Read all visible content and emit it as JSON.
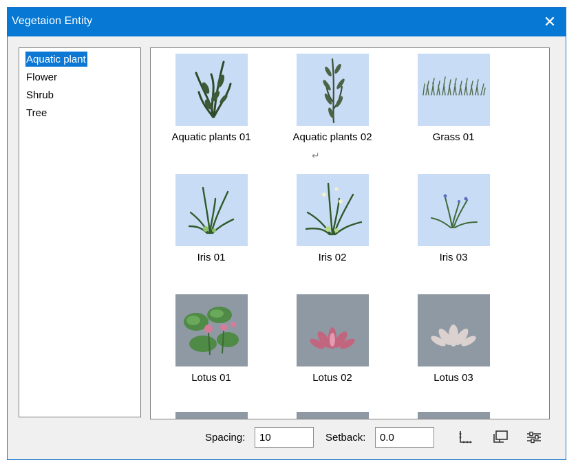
{
  "window": {
    "title": "Vegetaion Entity",
    "close_label": "✕"
  },
  "categories": [
    {
      "label": "Aquatic plant",
      "selected": true
    },
    {
      "label": "Flower",
      "selected": false
    },
    {
      "label": "Shrub",
      "selected": false
    },
    {
      "label": "Tree",
      "selected": false
    }
  ],
  "gallery": {
    "items": [
      {
        "label": "Aquatic plants 01",
        "icon": "aquatic-plant-thumbnail"
      },
      {
        "label": "Aquatic plants 02",
        "icon": "aquatic-plant-thumbnail"
      },
      {
        "label": "Grass 01",
        "icon": "grass-thumbnail"
      },
      {
        "label": "Iris 01",
        "icon": "iris-thumbnail"
      },
      {
        "label": "Iris 02",
        "icon": "iris-thumbnail"
      },
      {
        "label": "Iris 03",
        "icon": "iris-thumbnail"
      },
      {
        "label": "Lotus 01",
        "icon": "lotus-thumbnail"
      },
      {
        "label": "Lotus 02",
        "icon": "lotus-thumbnail"
      },
      {
        "label": "Lotus 03",
        "icon": "lotus-thumbnail"
      }
    ],
    "return_glyph": "↵"
  },
  "bottom": {
    "spacing_label": "Spacing:",
    "spacing_value": "10",
    "setback_label": "Setback:",
    "setback_value": "0.0",
    "tools": [
      "point-layout-icon",
      "monitor-layout-icon",
      "settings-sliders-icon"
    ]
  },
  "colors": {
    "title_bar": "#0778d3",
    "selection": "#0c78d4",
    "thumb_light_bg": "#c9dcf5",
    "thumb_gray_bg": "#8f99a4"
  }
}
